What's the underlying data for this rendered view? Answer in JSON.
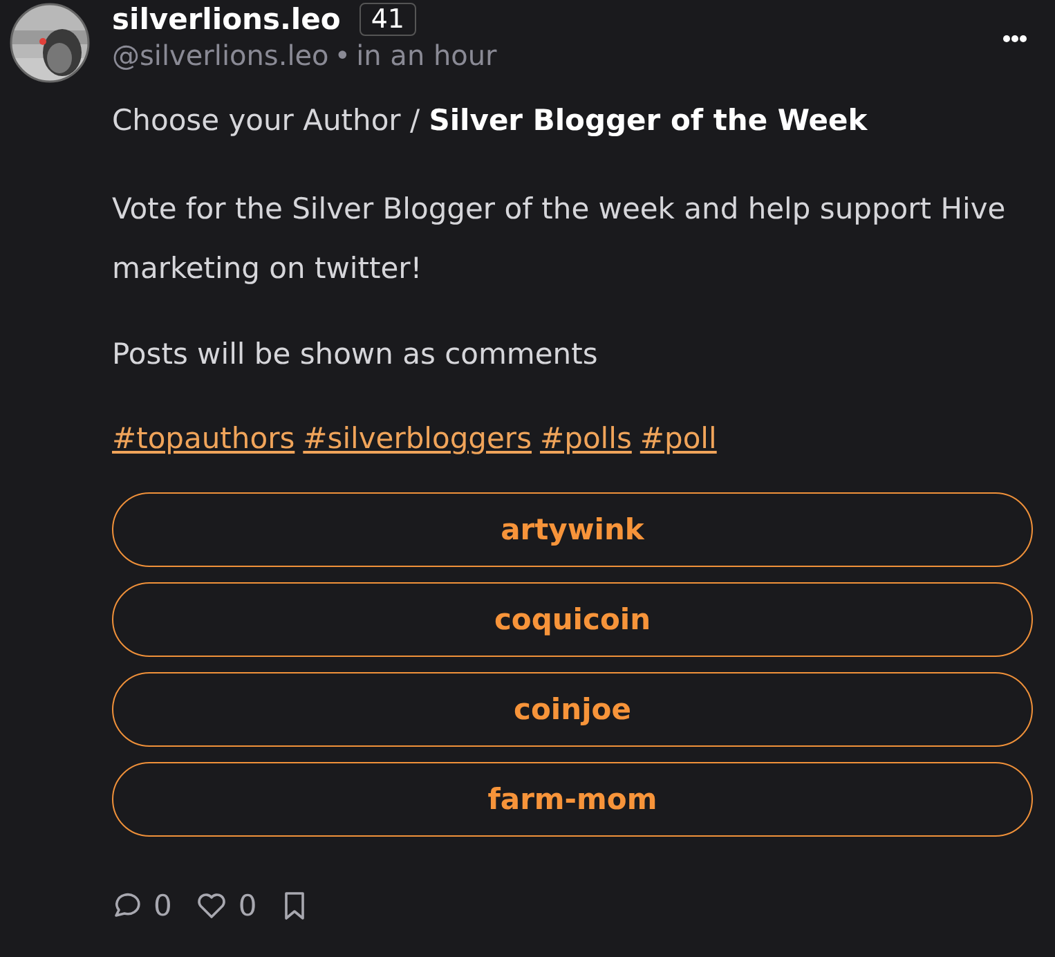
{
  "post": {
    "author": "silverlions.leo",
    "reputation": "41",
    "handle": "@silverlions.leo",
    "separator": "•",
    "time": "in an hour",
    "title_prefix": "Choose your Author / ",
    "title_bold": "Silver Blogger of the Week",
    "paragraphs": [
      "Vote for the Silver Blogger of the week and help support Hive marketing on twitter!",
      "Posts will be shown as comments"
    ],
    "tags": [
      "#topauthors",
      "#silverbloggers",
      "#polls",
      "#poll"
    ],
    "poll_options": [
      {
        "label": "artywink"
      },
      {
        "label": "coquicoin"
      },
      {
        "label": "coinjoe"
      },
      {
        "label": "farm-mom"
      }
    ],
    "comments": "0",
    "likes": "0"
  }
}
